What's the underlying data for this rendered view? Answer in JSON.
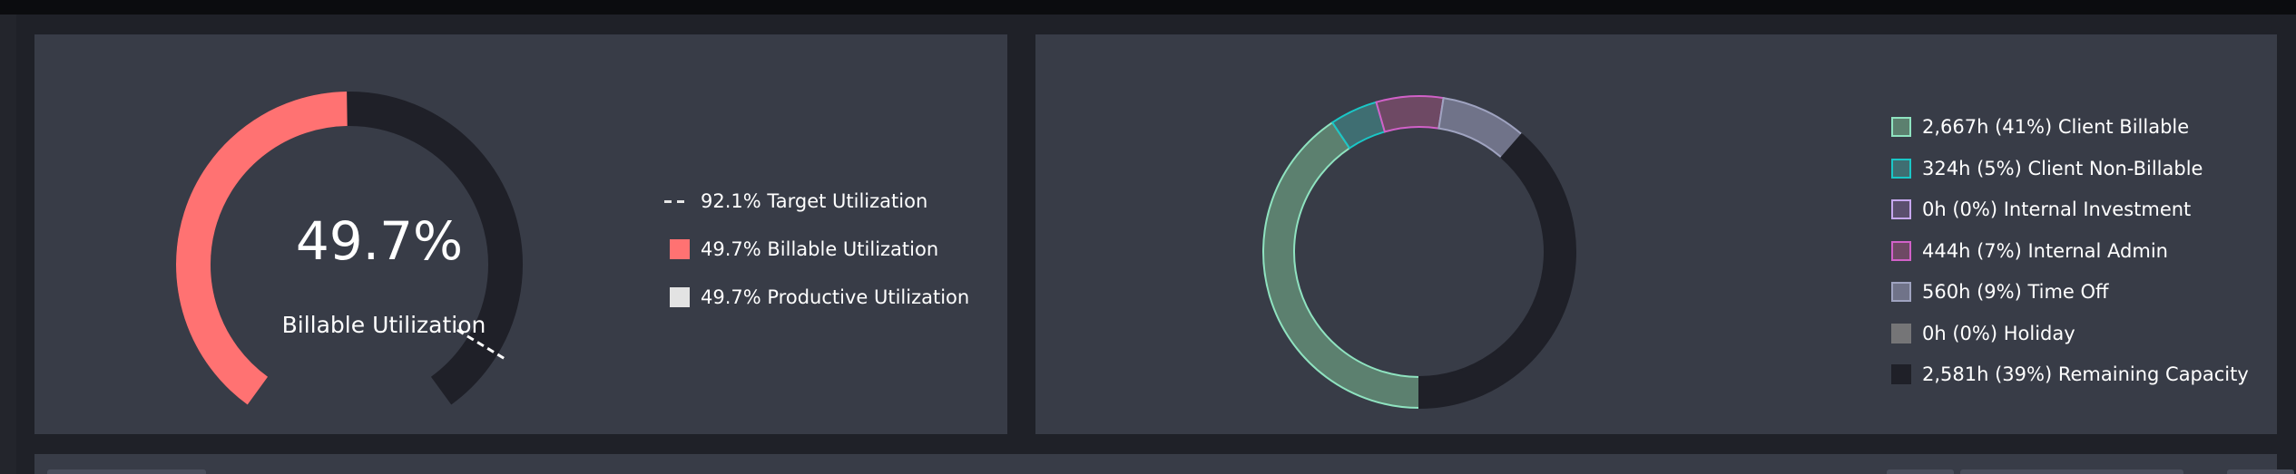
{
  "utilization": {
    "big_value": "49.7%",
    "big_label": "Billable Utilization",
    "billable_fraction": 0.497,
    "target_fraction": 0.921,
    "colors": {
      "billable": "#ff7272",
      "track": "#1f2028",
      "target_marker": "#ffffff"
    },
    "legend": [
      {
        "label": "92.1% Target Utilization",
        "swatch": "dash",
        "color": "#e6e6e6"
      },
      {
        "label": "49.7% Billable Utilization",
        "swatch": "square",
        "color": "#ff7272"
      },
      {
        "label": "49.7% Productive Utilization",
        "swatch": "square",
        "color": "#e3e3e3"
      }
    ]
  },
  "breakdown": {
    "colors": {
      "track": "#1f2028"
    },
    "segments": [
      {
        "label": "2,667h (41%) Client Billable",
        "fraction": 0.41,
        "fill": "#5c806f",
        "stroke": "#8fe3c0"
      },
      {
        "label": "324h (5%) Client Non-Billable",
        "fraction": 0.05,
        "fill": "#3f6e72",
        "stroke": "#1ac7c7"
      },
      {
        "label": "0h (0%) Internal Investment",
        "fraction": 0.0,
        "fill": "#5b4f6e",
        "stroke": "#c7a7ef"
      },
      {
        "label": "444h (7%) Internal Admin",
        "fraction": 0.07,
        "fill": "#6e4964",
        "stroke": "#d161c8"
      },
      {
        "label": "560h (9%) Time Off",
        "fraction": 0.09,
        "fill": "#707389",
        "stroke": "#9fa3c0"
      },
      {
        "label": "0h (0%) Holiday",
        "fraction": 0.0,
        "fill": "#757577",
        "stroke": "#757577"
      },
      {
        "label": "2,581h (39%) Remaining Capacity",
        "fraction": 0.39,
        "fill": "#1f2028",
        "stroke": "#1f2028"
      }
    ]
  }
}
